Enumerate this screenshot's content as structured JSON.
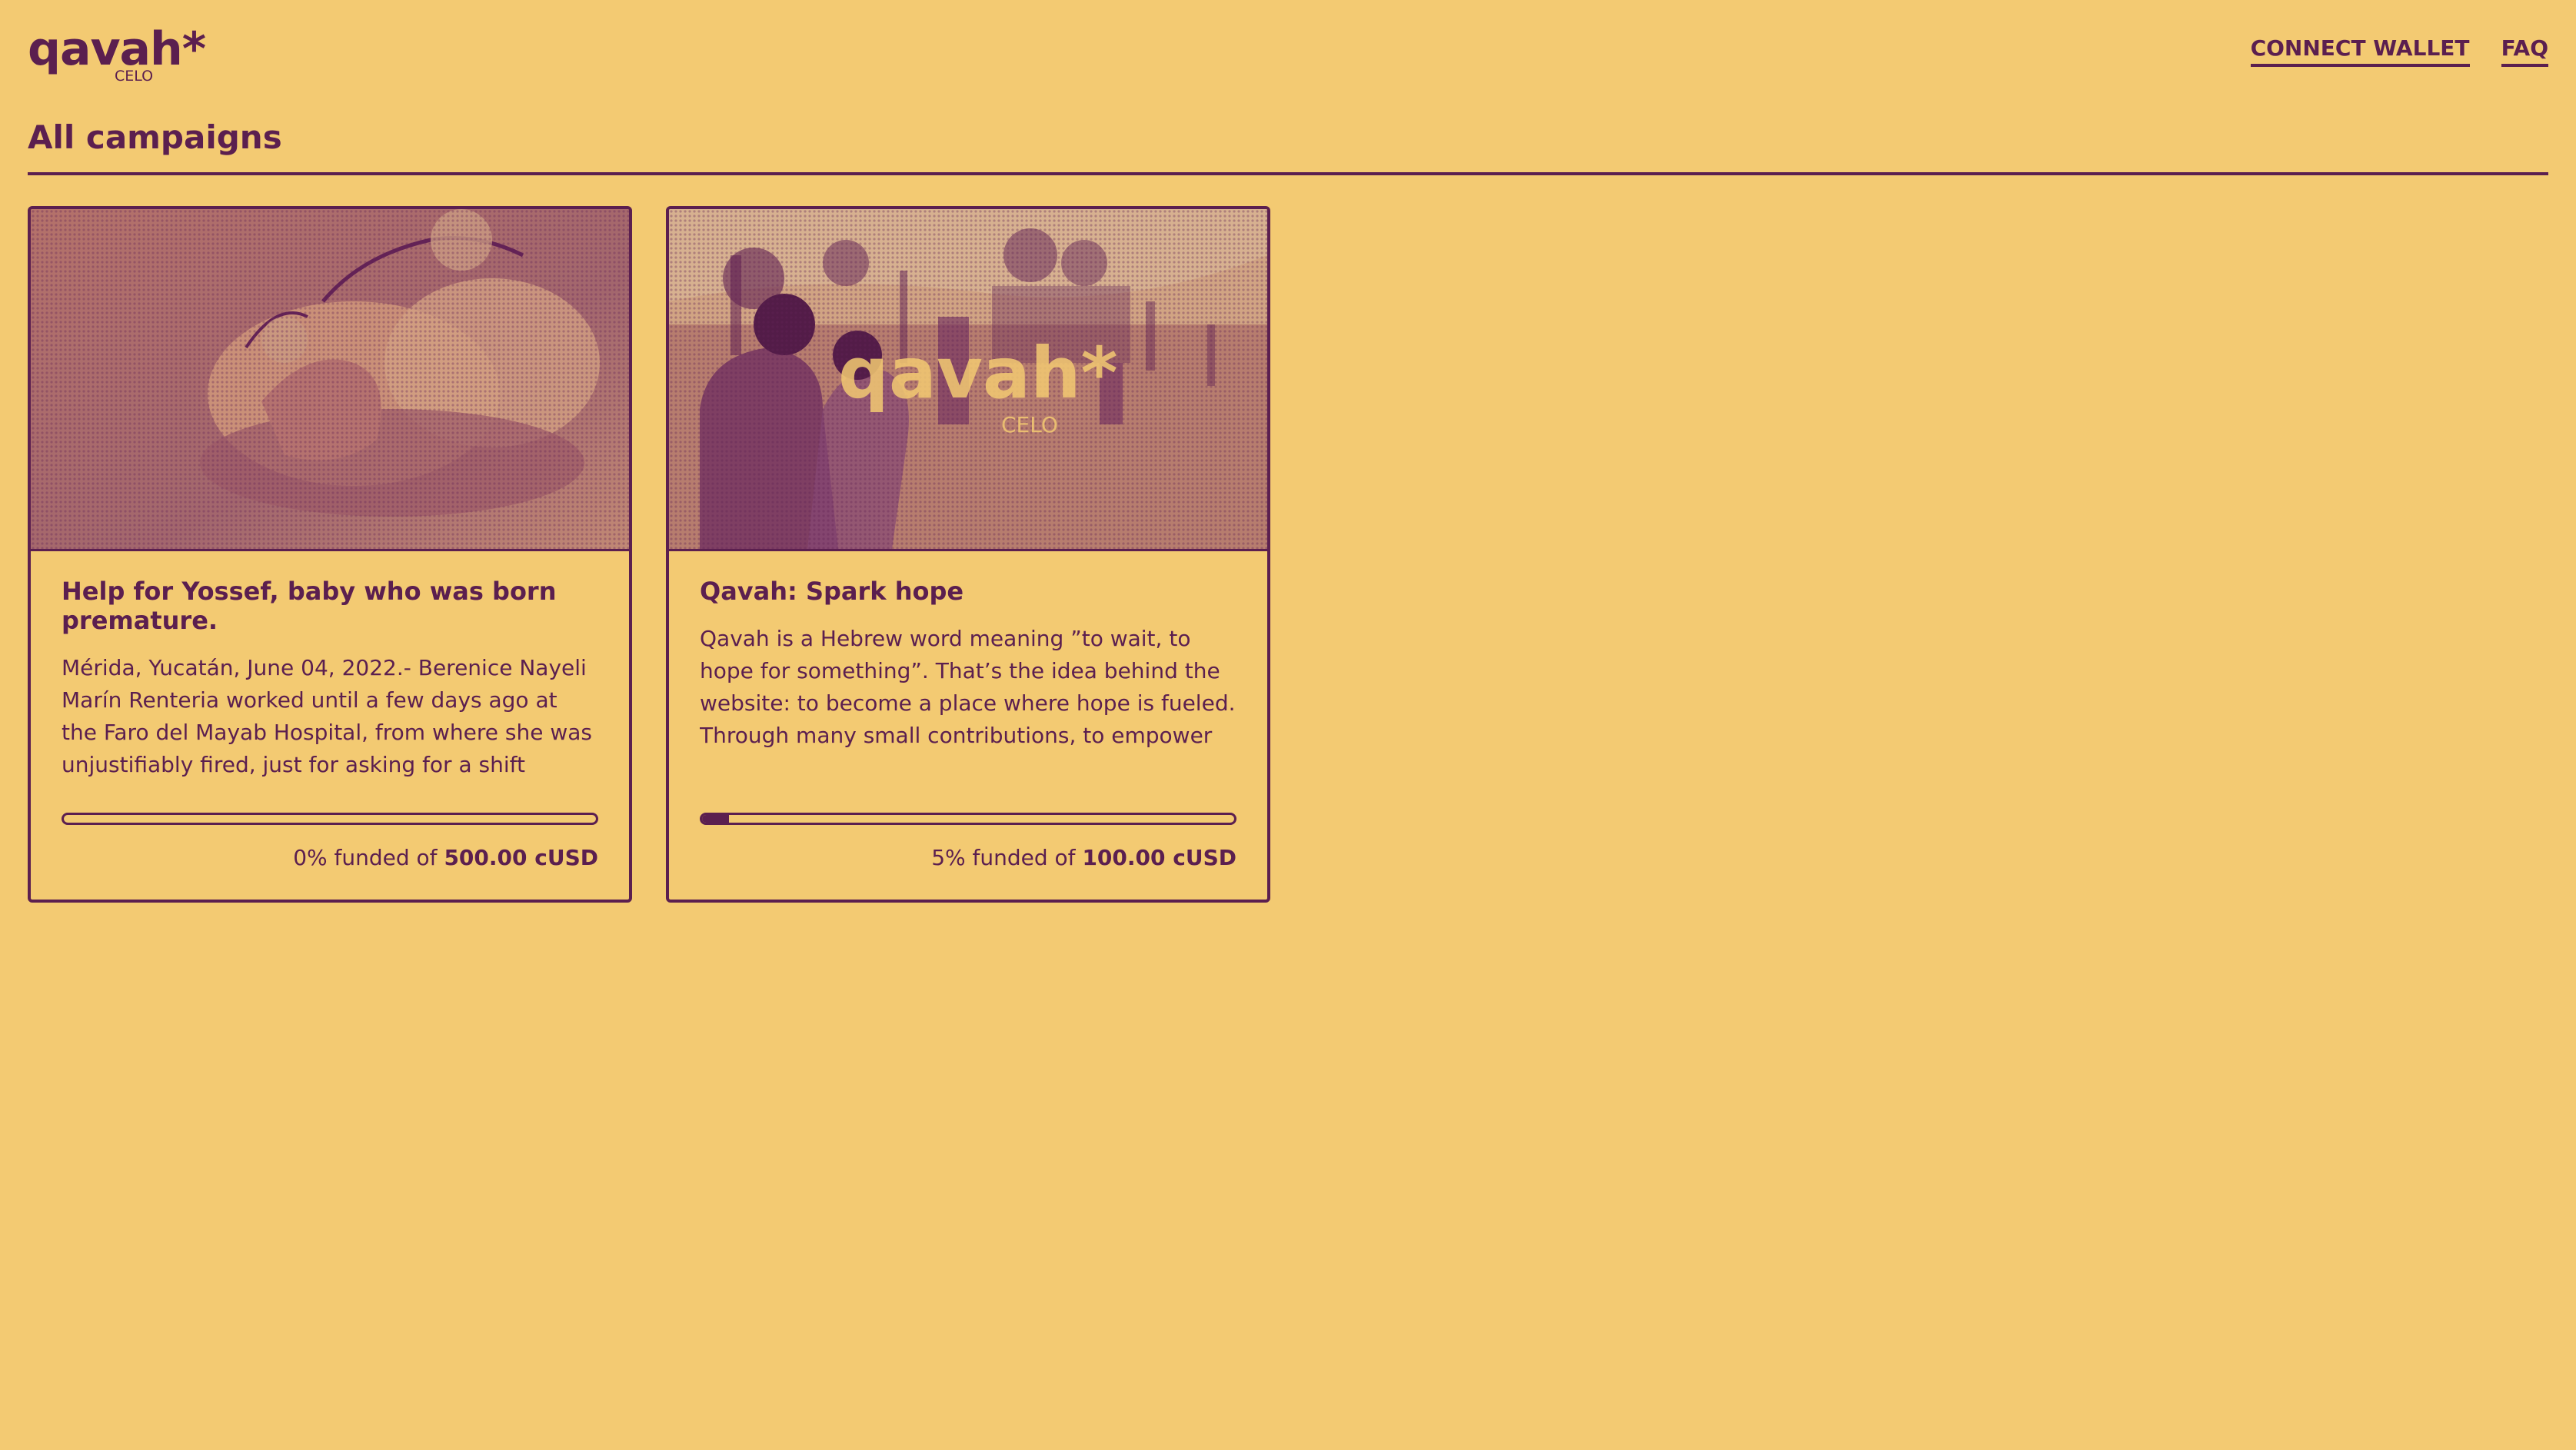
{
  "header": {
    "logo_text": "qavah*",
    "logo_sub": "CELO",
    "nav": {
      "connect_wallet": "CONNECT WALLET",
      "faq": "FAQ"
    }
  },
  "main": {
    "section_title": "All campaigns",
    "campaigns": [
      {
        "title": "Help for Yossef, baby who was born premature.",
        "description": "Mérida, Yucatán, June 04, 2022.- Berenice Nayeli Marín Renteria worked until a few days ago at the Faro del Mayab Hospital, from where she was unjustifiably fired, just for asking for a shift chang...",
        "progress_fraction": 0.0,
        "funded_prefix": "0% funded of",
        "goal": "500.00 cUSD",
        "image": "baby-hand-photo"
      },
      {
        "title": "Qavah: Spark hope",
        "description": "Qavah is a Hebrew word meaning ”to wait, to hope for something”. That’s the idea behind the website: to become a place where hope is fueled. Through many small contributions, to empower individuals...",
        "progress_fraction": 0.05,
        "funded_prefix": "5% funded of",
        "goal": "100.00 cUSD",
        "image": "children-street-photo",
        "image_logo_text": "qavah*",
        "image_logo_sub": "CELO"
      }
    ]
  },
  "colors": {
    "background": "#f3ca72",
    "accent": "#5b1f4f"
  }
}
